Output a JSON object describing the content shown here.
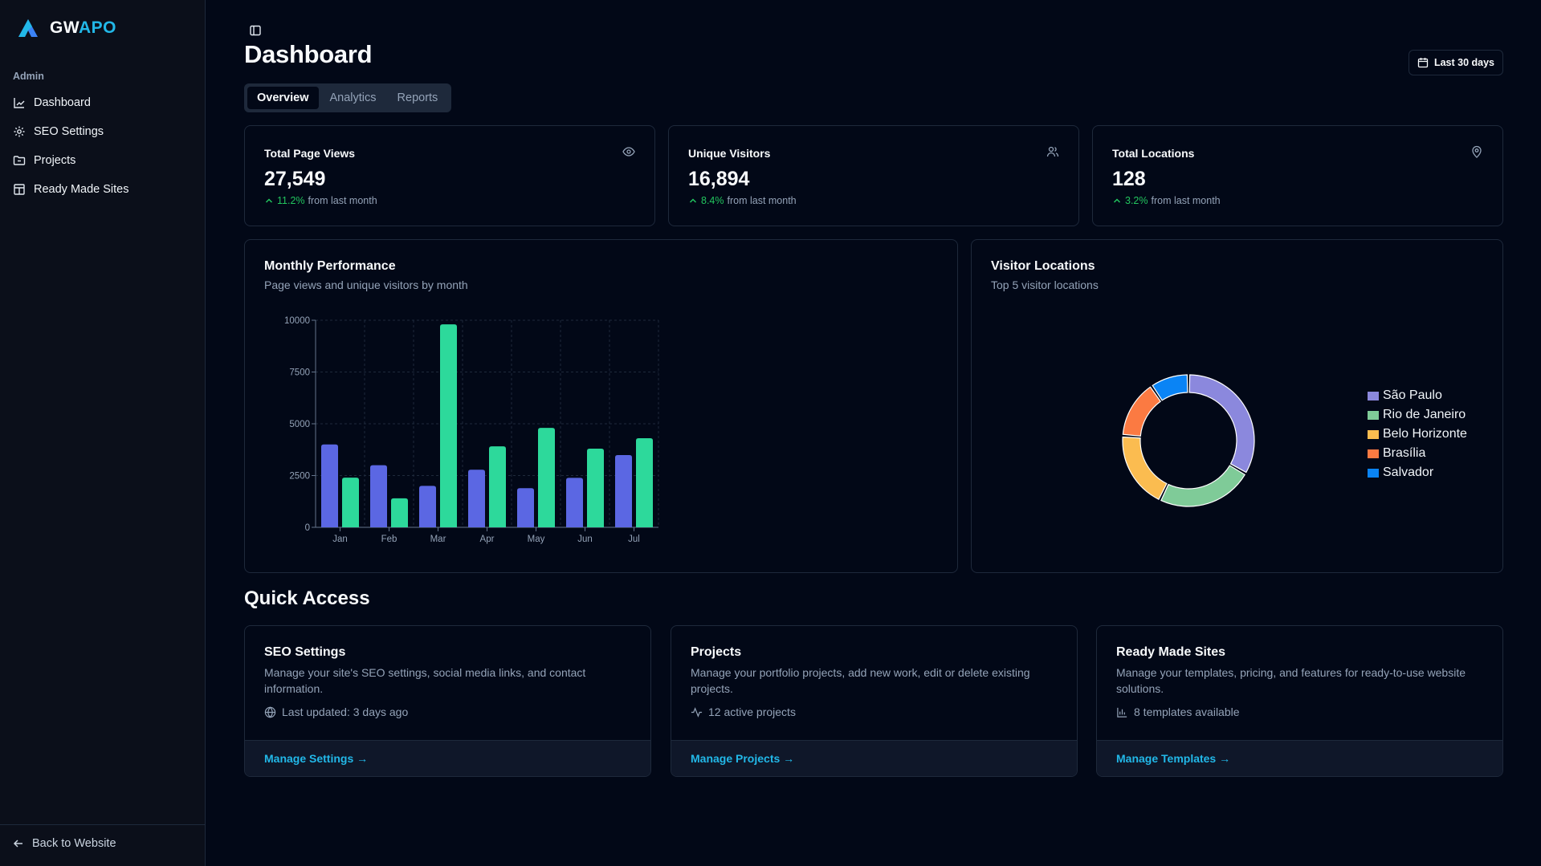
{
  "brand": {
    "part1": "GW",
    "part2": "APO"
  },
  "sidebar": {
    "section_label": "Admin",
    "items": [
      {
        "label": "Dashboard",
        "icon": "chart-icon"
      },
      {
        "label": "SEO Settings",
        "icon": "gear-icon"
      },
      {
        "label": "Projects",
        "icon": "folder-icon"
      },
      {
        "label": "Ready Made Sites",
        "icon": "layout-icon"
      }
    ],
    "back_label": "Back to Website"
  },
  "header": {
    "title": "Dashboard",
    "date_range": "Last 30 days",
    "tabs": [
      "Overview",
      "Analytics",
      "Reports"
    ],
    "active_tab": "Overview"
  },
  "stats": [
    {
      "title": "Total Page Views",
      "value": "27,549",
      "change": "11.2%",
      "change_suffix": "from last month",
      "icon": "eye-icon"
    },
    {
      "title": "Unique Visitors",
      "value": "16,894",
      "change": "8.4%",
      "change_suffix": "from last month",
      "icon": "users-icon"
    },
    {
      "title": "Total Locations",
      "value": "128",
      "change": "3.2%",
      "change_suffix": "from last month",
      "icon": "map-pin-icon"
    }
  ],
  "performance": {
    "title": "Monthly Performance",
    "subtitle": "Page views and unique visitors by month"
  },
  "locations": {
    "title": "Visitor Locations",
    "subtitle": "Top 5 visitor locations"
  },
  "chart_data": [
    {
      "type": "bar",
      "categories": [
        "Jan",
        "Feb",
        "Mar",
        "Apr",
        "May",
        "Jun",
        "Jul"
      ],
      "series": [
        {
          "values": [
            4000,
            3000,
            2000,
            2780,
            1890,
            2390,
            3490
          ],
          "color": "#5b67e3"
        },
        {
          "values": [
            2400,
            1398,
            9800,
            3908,
            4800,
            3800,
            4300
          ],
          "color": "#2dd99b"
        }
      ],
      "yticks": [
        0,
        2500,
        5000,
        7500,
        10000
      ],
      "ylim": [
        0,
        10000
      ],
      "grid": true
    },
    {
      "type": "pie",
      "labels": [
        "São Paulo",
        "Rio de Janeiro",
        "Belo Horizonte",
        "Brasília",
        "Salvador"
      ],
      "values": [
        35,
        25,
        20,
        15,
        10
      ],
      "colors": [
        "#8b88dd",
        "#7fcb98",
        "#fbbc50",
        "#fb7a42",
        "#0a84f5"
      ],
      "legend": "right"
    }
  ],
  "quick_access": {
    "title": "Quick Access",
    "cards": [
      {
        "title": "SEO Settings",
        "desc": "Manage your site's SEO settings, social media links, and contact information.",
        "meta": "Last updated: 3 days ago",
        "meta_icon": "globe-icon",
        "link": "Manage Settings →"
      },
      {
        "title": "Projects",
        "desc": "Manage your portfolio projects, add new work, edit or delete existing projects.",
        "meta": "12 active projects",
        "meta_icon": "activity-icon",
        "link": "Manage Projects →"
      },
      {
        "title": "Ready Made Sites",
        "desc": "Manage your templates, pricing, and features for ready-to-use website solutions.",
        "meta": "8 templates available",
        "meta_icon": "bar-chart-icon",
        "link": "Manage Templates →"
      }
    ]
  }
}
